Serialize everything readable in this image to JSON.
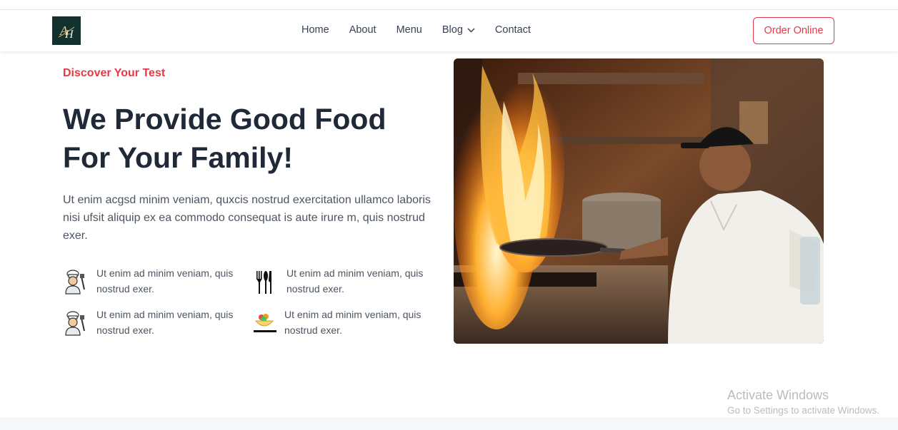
{
  "brand": {
    "logo_text": "AH"
  },
  "nav": {
    "items": [
      {
        "label": "Home"
      },
      {
        "label": "About"
      },
      {
        "label": "Menu"
      },
      {
        "label": "Blog",
        "has_dropdown": true
      },
      {
        "label": "Contact"
      }
    ],
    "order_button": "Order Online"
  },
  "hero": {
    "eyebrow": "Discover Your Test",
    "headline_line1": "We Provide Good Food",
    "headline_line2": "For Your Family!",
    "lead": "Ut enim acgsd minim veniam, quxcis nostrud exercitation ullamco laboris nisi ufsit aliquip ex ea commodo consequat is aute irure m, quis nostrud exer.",
    "features": [
      {
        "text": "Ut enim ad minim veniam, quis nostrud exer.",
        "icon": "chef-icon"
      },
      {
        "text": "Ut enim ad minim veniam, quis nostrud exer.",
        "icon": "cutlery-icon"
      },
      {
        "text": "Ut enim ad minim veniam, quis nostrud exer.",
        "icon": "chef-icon"
      },
      {
        "text": "Ut enim ad minim veniam, quis nostrud exer.",
        "icon": "salad-bowl-icon"
      }
    ],
    "image": {
      "subject": "chef cooking with flaming wok in kitchen"
    }
  },
  "watermark": {
    "line1": "Activate Windows",
    "line2": "Go to Settings to activate Windows."
  },
  "colors": {
    "accent": "#e53945",
    "heading": "#1f2937",
    "body_text": "#4b5563",
    "logo_bg": "#12302e"
  }
}
